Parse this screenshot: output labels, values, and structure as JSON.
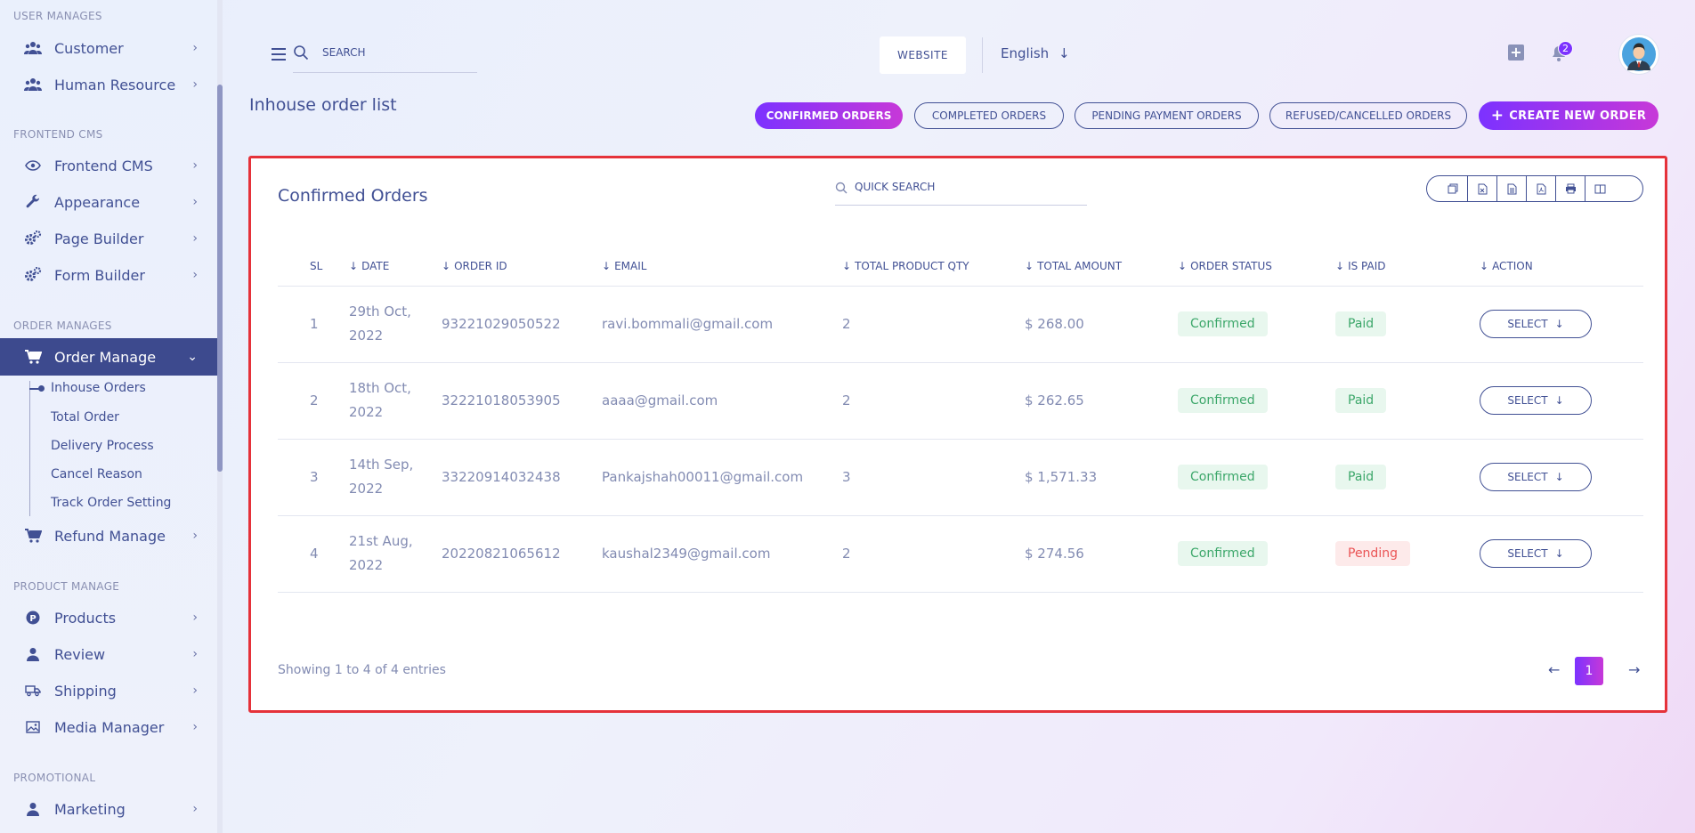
{
  "sidebar": {
    "sections": {
      "user": "USER MANAGES",
      "frontend": "FRONTEND CMS",
      "order": "ORDER MANAGES",
      "product": "PRODUCT MANAGE",
      "promo": "PROMOTIONAL"
    },
    "items": {
      "customer": "Customer",
      "human_resource": "Human Resource",
      "frontend_cms": "Frontend CMS",
      "appearance": "Appearance",
      "page_builder": "Page Builder",
      "form_builder": "Form Builder",
      "order_manage": "Order Manage",
      "refund_manage": "Refund Manage",
      "products": "Products",
      "review": "Review",
      "shipping": "Shipping",
      "media_manager": "Media Manager",
      "marketing": "Marketing"
    },
    "sub_items": {
      "inhouse_orders": "Inhouse Orders",
      "total_order": "Total Order",
      "delivery_process": "Delivery Process",
      "cancel_reason": "Cancel Reason",
      "track_order_setting": "Track Order Setting"
    }
  },
  "header": {
    "search_placeholder": "SEARCH",
    "website_label": "WEBSITE",
    "language": "English",
    "notification_count": "2"
  },
  "page": {
    "title": "Inhouse order list",
    "tabs": [
      "CONFIRMED ORDERS",
      "COMPLETED ORDERS",
      "PENDING PAYMENT ORDERS",
      "REFUSED/CANCELLED ORDERS"
    ],
    "create_label": "CREATE NEW ORDER"
  },
  "card": {
    "title": "Confirmed Orders",
    "quick_search_placeholder": "QUICK SEARCH",
    "columns": [
      "SL",
      "DATE",
      "ORDER ID",
      "EMAIL",
      "TOTAL PRODUCT QTY",
      "TOTAL AMOUNT",
      "ORDER STATUS",
      "IS PAID",
      "ACTION"
    ],
    "rows": [
      {
        "sl": "1",
        "date_a": "29th Oct,",
        "date_b": "2022",
        "order_id": "93221029050522",
        "email": "ravi.bommali@gmail.com",
        "qty": "2",
        "amount": "$ 268.00",
        "status": "Confirmed",
        "paid": "Paid",
        "action": "SELECT"
      },
      {
        "sl": "2",
        "date_a": "18th Oct,",
        "date_b": "2022",
        "order_id": "32221018053905",
        "email": "aaaa@gmail.com",
        "qty": "2",
        "amount": "$ 262.65",
        "status": "Confirmed",
        "paid": "Paid",
        "action": "SELECT"
      },
      {
        "sl": "3",
        "date_a": "14th Sep,",
        "date_b": "2022",
        "order_id": "33220914032438",
        "email": "Pankajshah00011@gmail.com",
        "qty": "3",
        "amount": "$ 1,571.33",
        "status": "Confirmed",
        "paid": "Paid",
        "action": "SELECT"
      },
      {
        "sl": "4",
        "date_a": "21st Aug,",
        "date_b": "2022",
        "order_id": "20220821065612",
        "email": "kaushal2349@gmail.com",
        "qty": "2",
        "amount": "$ 274.56",
        "status": "Confirmed",
        "paid": "Pending",
        "action": "SELECT"
      }
    ],
    "showing": "Showing 1 to 4 of 4 entries",
    "current_page": "1"
  },
  "icons": {
    "export": [
      "copy-icon",
      "excel-icon",
      "csv-icon",
      "pdf-icon",
      "print-icon",
      "columns-icon"
    ]
  },
  "colors": {
    "accent": "#7c32ff",
    "accent_end": "#c738d8",
    "primary": "#415094",
    "highlight_border": "#e5323a",
    "paid_green": "#3ca76a",
    "pending_red": "#ea5455"
  }
}
